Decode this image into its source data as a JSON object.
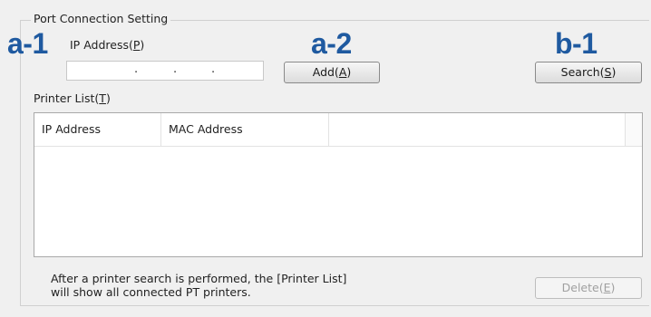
{
  "group": {
    "title": "Port Connection Setting"
  },
  "markers": {
    "a1": "a-1",
    "a2": "a-2",
    "b1": "b-1"
  },
  "ip_address": {
    "label_prefix": "IP Address(",
    "label_key": "P",
    "label_suffix": ")",
    "value": "",
    "dots": [
      ".",
      ".",
      "."
    ]
  },
  "buttons": {
    "add": {
      "prefix": "Add(",
      "key": "A",
      "suffix": ")"
    },
    "search": {
      "prefix": "Search(",
      "key": "S",
      "suffix": ")"
    },
    "delete": {
      "prefix": "Delete(",
      "key": "E",
      "suffix": ")",
      "enabled": false
    }
  },
  "printer_list": {
    "label_prefix": "Printer List(",
    "label_key": "T",
    "label_suffix": ")",
    "columns": [
      "IP Address",
      "MAC Address",
      ""
    ],
    "rows": []
  },
  "note": {
    "line1": "After a printer search is performed, the [Printer List]",
    "line2": "will show all connected PT printers."
  },
  "colors": {
    "marker": "#1f5aa0",
    "background": "#f0f0f0"
  }
}
